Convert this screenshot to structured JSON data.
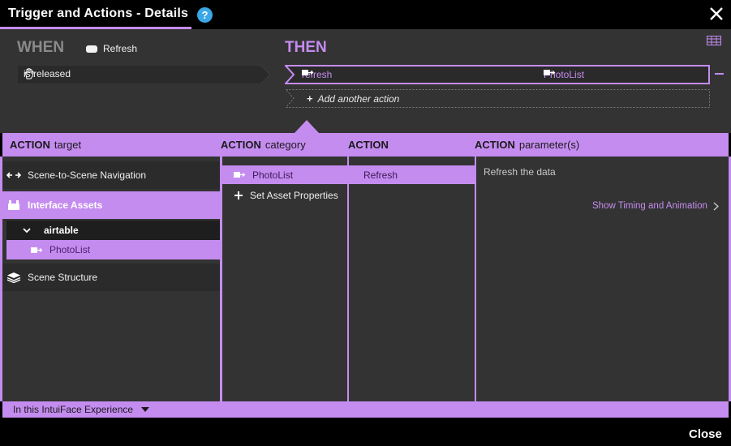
{
  "window": {
    "title": "Trigger and Actions - Details",
    "help_label": "?",
    "close_button_label": "Close"
  },
  "when": {
    "label": "WHEN",
    "source_name": "Refresh",
    "trigger": "is released"
  },
  "then": {
    "label": "THEN",
    "actions": [
      {
        "action": "refresh",
        "target": "PhotoList"
      }
    ],
    "add_action_label": "Add another action",
    "add_symbol": "+"
  },
  "headers": {
    "target": {
      "bold": "ACTION",
      "rest": "target"
    },
    "category": {
      "bold": "ACTION",
      "rest": "category"
    },
    "action": {
      "bold": "ACTION",
      "rest": ""
    },
    "params": {
      "bold": "ACTION",
      "rest": "parameter(s)"
    }
  },
  "targets": {
    "scene_nav": "Scene-to-Scene Navigation",
    "interface_assets": "Interface Assets",
    "group": "airtable",
    "asset": "PhotoList",
    "scene_structure": "Scene Structure"
  },
  "categories": [
    "PhotoList",
    "Set Asset Properties"
  ],
  "actions": [
    "Refresh"
  ],
  "parameters": {
    "description": "Refresh the data",
    "timing_link": "Show Timing and Animation"
  },
  "footer": {
    "scope": "In this IntuiFace Experience"
  },
  "colors": {
    "accent": "#c58cf0",
    "panel": "#333333",
    "help_blue": "#3aa7e6"
  }
}
